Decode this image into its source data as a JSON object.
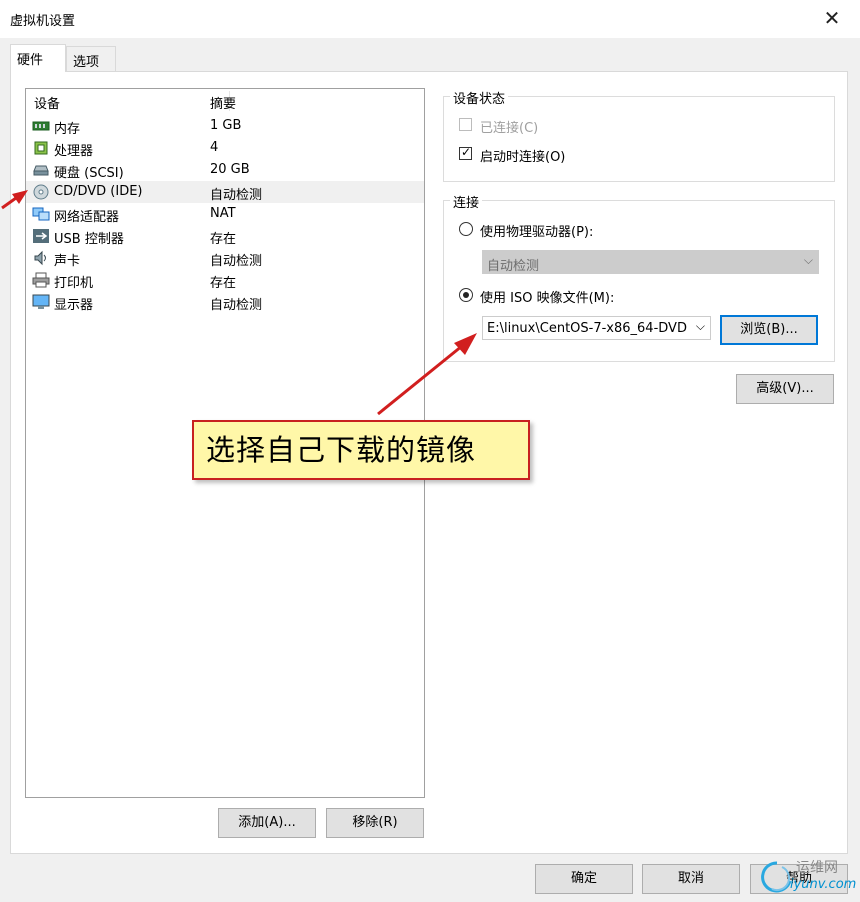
{
  "window": {
    "title": "虚拟机设置",
    "close_glyph": "✕"
  },
  "tabs": [
    {
      "label": "硬件",
      "active": true
    },
    {
      "label": "选项",
      "active": false
    }
  ],
  "device_list": {
    "header_device": "设备",
    "header_summary": "摘要",
    "rows": [
      {
        "icon": "memory-icon",
        "name": "内存",
        "summary": "1 GB"
      },
      {
        "icon": "processor-icon",
        "name": "处理器",
        "summary": "4"
      },
      {
        "icon": "hard-disk-icon",
        "name": "硬盘 (SCSI)",
        "summary": "20 GB"
      },
      {
        "icon": "cd-dvd-icon",
        "name": "CD/DVD (IDE)",
        "summary": "自动检测",
        "selected": true
      },
      {
        "icon": "network-adapter-icon",
        "name": "网络适配器",
        "summary": "NAT"
      },
      {
        "icon": "usb-icon",
        "name": "USB 控制器",
        "summary": "存在"
      },
      {
        "icon": "sound-card-icon",
        "name": "声卡",
        "summary": "自动检测"
      },
      {
        "icon": "printer-icon",
        "name": "打印机",
        "summary": "存在"
      },
      {
        "icon": "display-icon",
        "name": "显示器",
        "summary": "自动检测"
      }
    ],
    "add_button": "添加(A)...",
    "remove_button": "移除(R)"
  },
  "device_status": {
    "title": "设备状态",
    "connected": {
      "label": "已连接(C)",
      "checked": false,
      "enabled": false
    },
    "connect_on_start": {
      "label": "启动时连接(O)",
      "checked": true,
      "enabled": true
    }
  },
  "connection": {
    "title": "连接",
    "physical_drive": {
      "label": "使用物理驱动器(P):",
      "selected": false,
      "select_value": "自动检测"
    },
    "iso_image": {
      "label": "使用 ISO 映像文件(M):",
      "selected": true,
      "path_value": "E:\\linux\\CentOS-7-x86_64-DVD"
    },
    "browse_button": "浏览(B)..."
  },
  "advanced_button": "高级(V)...",
  "annotation": {
    "text": "选择自己下载的镜像",
    "arrow_color": "#d11f1f"
  },
  "footer": {
    "ok_button": "确定",
    "cancel_button": "取消",
    "help_button": "帮助"
  },
  "watermark": {
    "line1": "运维网",
    "line2": "iyunv.com"
  }
}
